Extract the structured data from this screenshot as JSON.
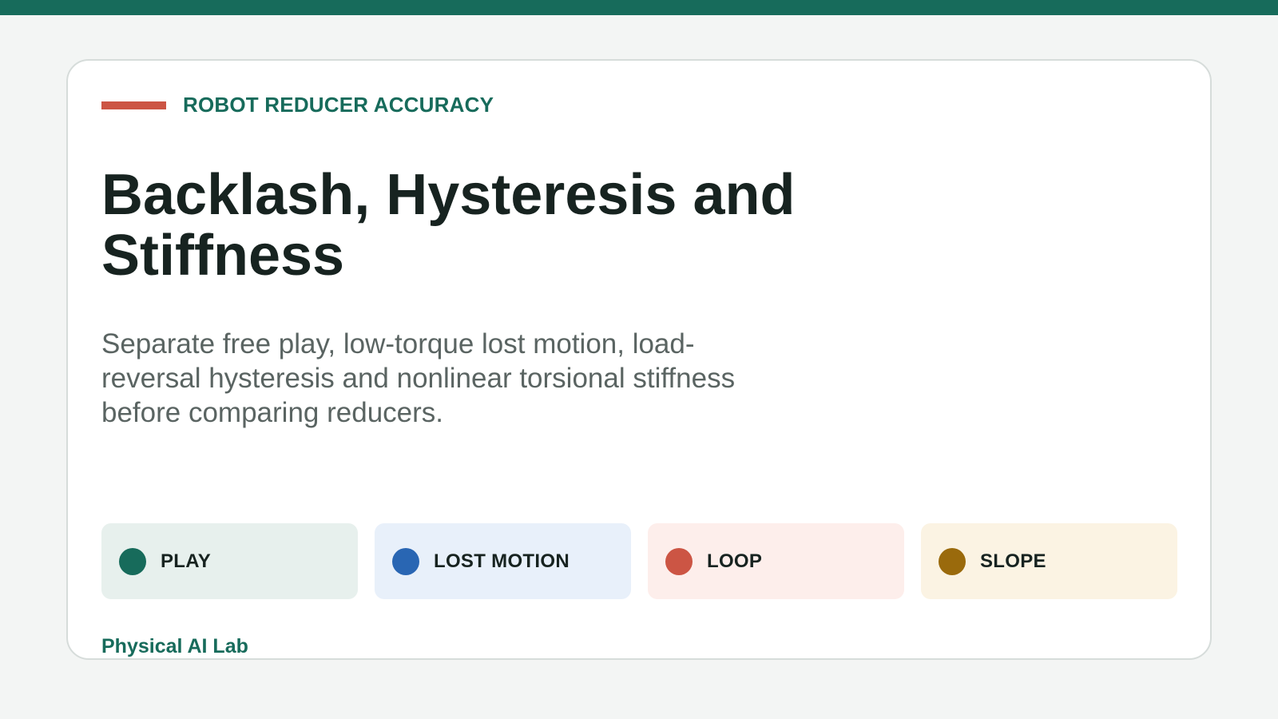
{
  "eyebrow": {
    "label": "ROBOT REDUCER ACCURACY",
    "accent_color": "#cc5544"
  },
  "title": "Backlash, Hysteresis and Stiffness",
  "subtitle": "Separate free play, low-torque lost motion, load-reversal hysteresis and nonlinear torsional stiffness before comparing reducers.",
  "chips": [
    {
      "label": "PLAY",
      "dot_color": "#176b5b",
      "bg_color": "#e7f0ed"
    },
    {
      "label": "LOST MOTION",
      "dot_color": "#2966b3",
      "bg_color": "#e8f0fa"
    },
    {
      "label": "LOOP",
      "dot_color": "#cc5544",
      "bg_color": "#fdeeeb"
    },
    {
      "label": "SLOPE",
      "dot_color": "#9a6a0c",
      "bg_color": "#fbf3e3"
    }
  ],
  "footer": "Physical AI Lab",
  "colors": {
    "brand": "#176b5b",
    "background": "#f3f5f4",
    "card": "#ffffff"
  }
}
